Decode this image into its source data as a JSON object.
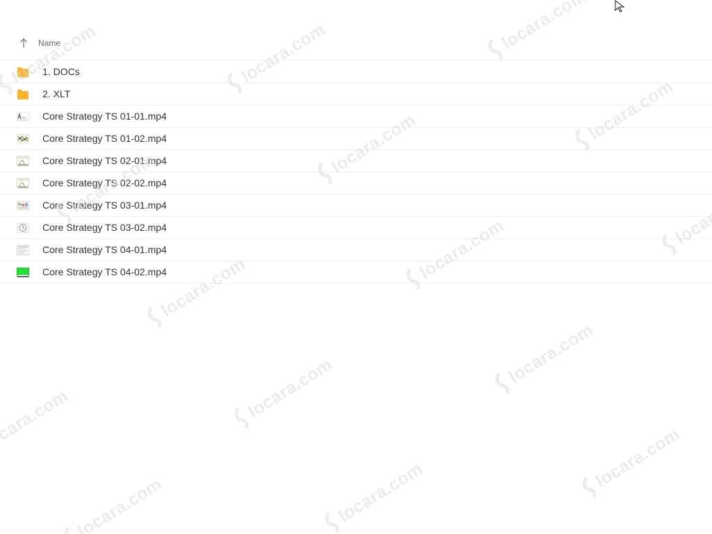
{
  "header": {
    "sort_column": "Name",
    "sort_icon": "arrow-up-icon"
  },
  "files": [
    {
      "name": "1. DOCs",
      "type": "folder",
      "icon": "folder-icon"
    },
    {
      "name": "2. XLT",
      "type": "folder",
      "icon": "folder-icon"
    },
    {
      "name": "Core Strategy TS 01-01.mp4",
      "type": "video",
      "icon": "video-thumbnail-icon"
    },
    {
      "name": "Core Strategy TS 01-02.mp4",
      "type": "video",
      "icon": "video-thumbnail-icon"
    },
    {
      "name": "Core Strategy TS 02-01.mp4",
      "type": "video",
      "icon": "video-thumbnail-icon"
    },
    {
      "name": "Core Strategy TS 02-02.mp4",
      "type": "video",
      "icon": "video-thumbnail-icon"
    },
    {
      "name": "Core Strategy TS 03-01.mp4",
      "type": "video",
      "icon": "video-thumbnail-icon"
    },
    {
      "name": "Core Strategy TS 03-02.mp4",
      "type": "video",
      "icon": "video-thumbnail-icon"
    },
    {
      "name": "Core Strategy TS 04-01.mp4",
      "type": "video",
      "icon": "video-thumbnail-icon"
    },
    {
      "name": "Core Strategy TS 04-02.mp4",
      "type": "video",
      "icon": "video-thumbnail-icon"
    }
  ],
  "watermark": {
    "text": "locara.com"
  },
  "colors": {
    "folder": "#f8b32b",
    "folder_tab": "#f39c12",
    "header_text": "#666666",
    "row_text": "#333333",
    "divider": "#f0f0f0",
    "watermark": "#d8d8d8"
  }
}
